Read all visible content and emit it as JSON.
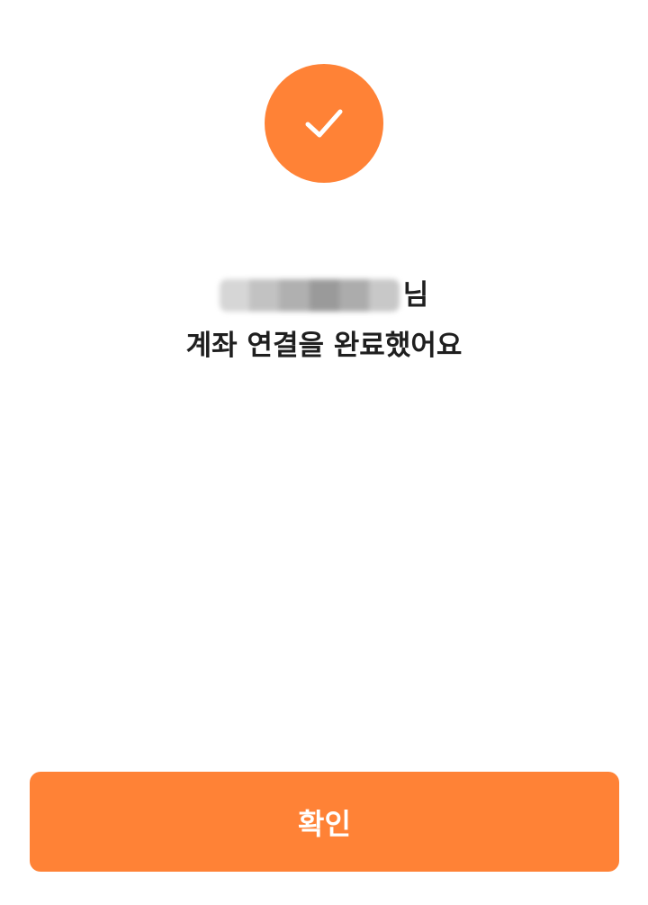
{
  "success_icon": {
    "icon": "check-icon",
    "color": "#ff8236"
  },
  "message": {
    "name_suffix": "님",
    "line2": "계좌 연결을 완료했어요"
  },
  "confirm_button": {
    "label": "확인",
    "color": "#ff8236"
  }
}
